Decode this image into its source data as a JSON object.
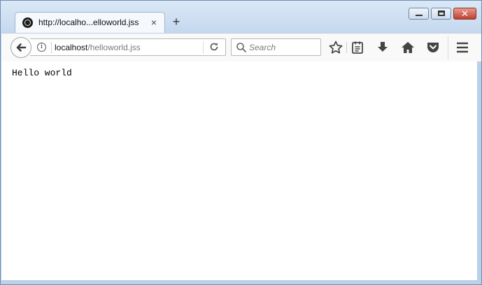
{
  "tab": {
    "title": "http://localho...elloworld.jss",
    "close_label": "×",
    "new_tab_label": "+"
  },
  "window_controls": {
    "close_label": "✕"
  },
  "urlbar": {
    "host": "localhost",
    "path": "/helloworld.jss"
  },
  "searchbar": {
    "placeholder": "Search"
  },
  "page": {
    "text": "Hello world"
  },
  "icons": [
    "firefox-tab-icon",
    "back-arrow-icon",
    "info-icon",
    "reload-icon",
    "search-icon",
    "bookmark-star-icon",
    "reading-list-icon",
    "download-icon",
    "home-icon",
    "pocket-icon",
    "menu-icon"
  ]
}
